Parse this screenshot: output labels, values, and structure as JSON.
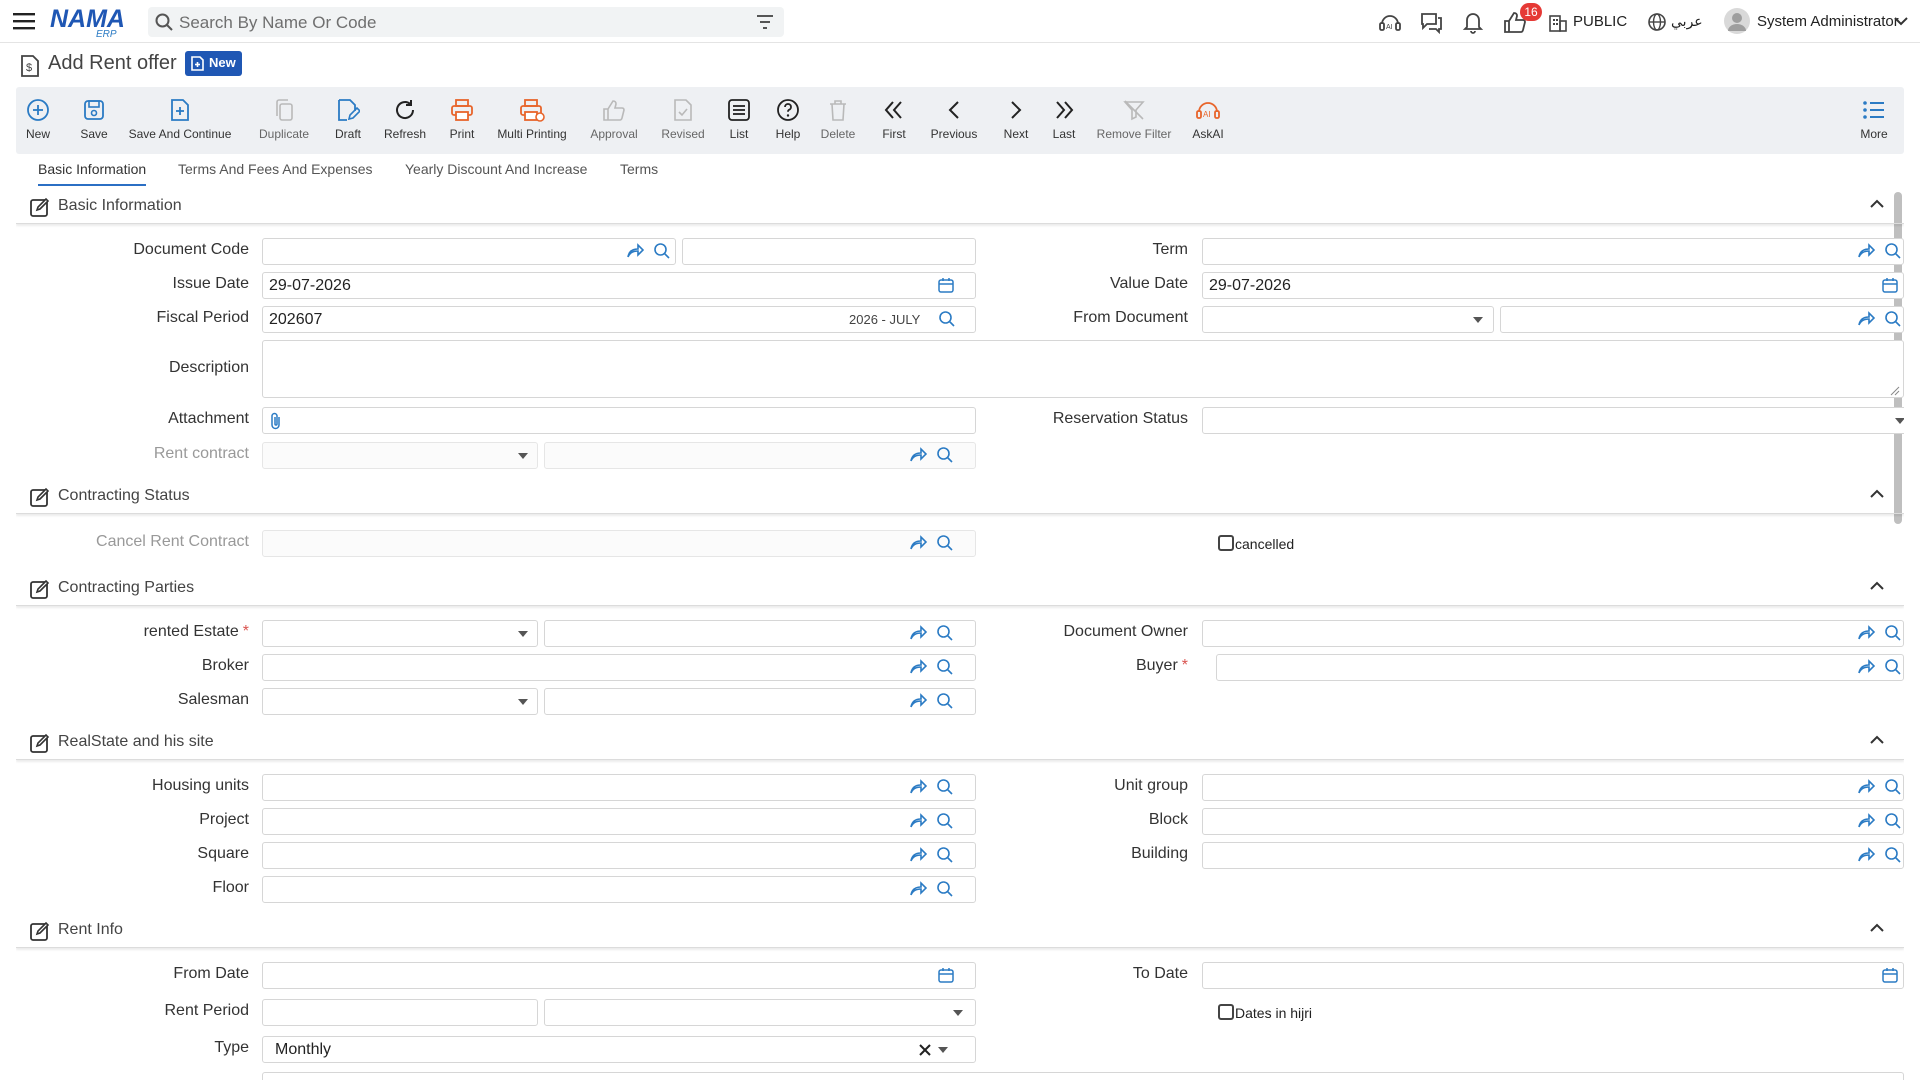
{
  "header": {
    "search_placeholder": "Search By Name Or Code",
    "notification_count": "16",
    "public_label": "PUBLIC",
    "language_label": "عربي",
    "user_name": "System Administrator"
  },
  "page": {
    "title": "Add Rent offer",
    "badge": "New"
  },
  "toolbar": {
    "new": "New",
    "save": "Save",
    "save_continue": "Save And Continue",
    "duplicate": "Duplicate",
    "draft": "Draft",
    "refresh": "Refresh",
    "print": "Print",
    "multi_printing": "Multi Printing",
    "approval": "Approval",
    "revised": "Revised",
    "list": "List",
    "help": "Help",
    "delete": "Delete",
    "first": "First",
    "previous": "Previous",
    "next": "Next",
    "last": "Last",
    "remove_filter": "Remove Filter",
    "askai": "AskAI",
    "more": "More"
  },
  "tabs": [
    "Basic Information",
    "Terms And Fees And Expenses",
    "Yearly Discount And Increase",
    "Terms"
  ],
  "sections": {
    "basic": {
      "title": "Basic Information",
      "document_code": "Document Code",
      "term": "Term",
      "issue_date": "Issue Date",
      "issue_date_value": "29-07-2026",
      "value_date": "Value Date",
      "value_date_value": "29-07-2026",
      "fiscal_period": "Fiscal Period",
      "fiscal_period_value": "202607",
      "fiscal_period_hint": "2026 - JULY",
      "from_document": "From Document",
      "description": "Description",
      "attachment": "Attachment",
      "reservation_status": "Reservation Status",
      "rent_contract": "Rent contract"
    },
    "contracting_status": {
      "title": "Contracting Status",
      "cancel_rent_contract": "Cancel Rent Contract",
      "cancelled": "cancelled"
    },
    "contracting_parties": {
      "title": "Contracting Parties",
      "rented_estate": "rented Estate",
      "document_owner": "Document Owner",
      "broker": "Broker",
      "buyer": "Buyer",
      "salesman": "Salesman"
    },
    "realstate": {
      "title": "RealState and his site",
      "housing_units": "Housing units",
      "unit_group": "Unit group",
      "project": "Project",
      "block": "Block",
      "square": "Square",
      "building": "Building",
      "floor": "Floor"
    },
    "rent_info": {
      "title": "Rent Info",
      "from_date": "From Date",
      "to_date": "To Date",
      "rent_period": "Rent Period",
      "dates_in_hijri": "Dates in hijri",
      "type": "Type",
      "type_value": "Monthly"
    }
  },
  "colors": {
    "accent": "#1f57b4",
    "icon_blue": "#2b7bc4",
    "print_orange": "#e8652b",
    "badge_red": "#e53935"
  }
}
